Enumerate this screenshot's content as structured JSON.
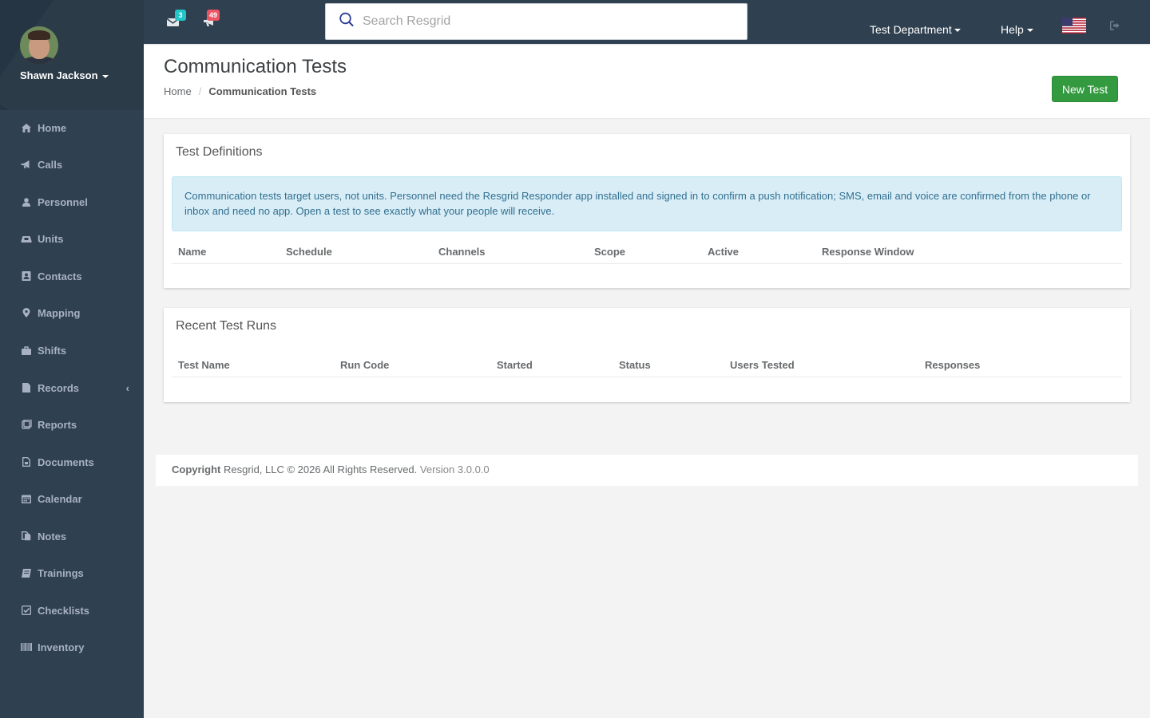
{
  "user": {
    "name": "Shawn Jackson"
  },
  "sidebar": {
    "items": [
      {
        "label": "Home",
        "icon": "home-icon"
      },
      {
        "label": "Calls",
        "icon": "bullhorn-icon"
      },
      {
        "label": "Personnel",
        "icon": "user-icon"
      },
      {
        "label": "Units",
        "icon": "truck-icon"
      },
      {
        "label": "Contacts",
        "icon": "address-book-icon"
      },
      {
        "label": "Mapping",
        "icon": "map-marker-icon"
      },
      {
        "label": "Shifts",
        "icon": "briefcase-icon"
      },
      {
        "label": "Records",
        "icon": "file-icon"
      },
      {
        "label": "Reports",
        "icon": "report-icon"
      },
      {
        "label": "Documents",
        "icon": "document-icon"
      },
      {
        "label": "Calendar",
        "icon": "calendar-icon"
      },
      {
        "label": "Notes",
        "icon": "notes-icon"
      },
      {
        "label": "Trainings",
        "icon": "book-icon"
      },
      {
        "label": "Checklists",
        "icon": "checklist-icon"
      },
      {
        "label": "Inventory",
        "icon": "barcode-icon"
      }
    ]
  },
  "topbar": {
    "messages_count": "3",
    "calls_count": "49",
    "search_placeholder": "Search Resgrid",
    "department": "Test Department",
    "help": "Help",
    "colors": {
      "bar": "#2f4050",
      "messages_badge": "#23c6c8",
      "calls_badge": "#ed5565"
    }
  },
  "heading": {
    "title": "Communication Tests",
    "breadcrumb_home": "Home",
    "breadcrumb_active": "Communication Tests",
    "new_button": "New Test"
  },
  "definitions": {
    "title": "Test Definitions",
    "notice": "Communication tests target users, not units. Personnel need the Resgrid Responder app installed and signed in to confirm a push notification; SMS, email and voice are confirmed from the phone or inbox and need no app. Open a test to see exactly what your people will receive.",
    "columns": [
      "Name",
      "Schedule",
      "Channels",
      "Scope",
      "Active",
      "Response Window"
    ]
  },
  "runs": {
    "title": "Recent Test Runs",
    "columns": [
      "Test Name",
      "Run Code",
      "Started",
      "Status",
      "Users Tested",
      "Responses"
    ]
  },
  "footer": {
    "copyright_label": "Copyright",
    "copyright_text": "Resgrid, LLC © 2026 All Rights Reserved.",
    "version": "Version 3.0.0.0"
  }
}
